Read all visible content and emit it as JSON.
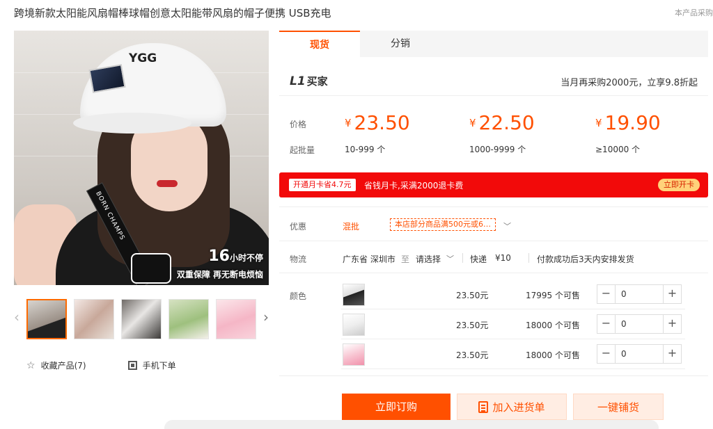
{
  "product_title": "跨境新款太阳能风扇帽棒球帽创意太阳能带风扇的帽子便携 USB充电",
  "top_right_note": "本产品采购",
  "image_overlay": {
    "line1_num": "16",
    "line1_text": "小时不停",
    "line2": "双重保障 再无断电烦恼"
  },
  "cap_text": "YGG",
  "strap_text": "BORN CHAMPS",
  "left_actions": {
    "favorite": "收藏产品(7)",
    "mobile": "手机下单"
  },
  "tabs": [
    "现货",
    "分销"
  ],
  "buyer": {
    "level": "L1",
    "label": "买家",
    "note": "当月再采购2000元，立享9.8折起"
  },
  "pricing": {
    "price_label": "价格",
    "moq_label": "起批量",
    "currency": "¥",
    "tiers": [
      {
        "price": "23.50",
        "range": "10-999 个"
      },
      {
        "price": "22.50",
        "range": "1000-9999 个"
      },
      {
        "price": "19.90",
        "range": "≥10000 个"
      }
    ]
  },
  "promo": {
    "tag": "开通月卡省4.7元",
    "text": "省钱月卡,采满2000退卡费",
    "button": "立即开卡"
  },
  "discount": {
    "label": "优惠",
    "type": "混批",
    "coupon": "本店部分商品满500元或6…"
  },
  "logistics": {
    "label": "物流",
    "origin": "广东省 深圳市",
    "to": "至",
    "select": "请选择",
    "method": "快递",
    "fee": "¥10",
    "note": "付款成功后3天内安排发货"
  },
  "color": {
    "label": "颜色",
    "rows": [
      {
        "swatch": "black",
        "price": "23.50元",
        "stock": "17995 个可售",
        "qty": "0"
      },
      {
        "swatch": "white",
        "price": "23.50元",
        "stock": "18000 个可售",
        "qty": "0"
      },
      {
        "swatch": "pink",
        "price": "23.50元",
        "stock": "18000 个可售",
        "qty": "0"
      }
    ]
  },
  "cta": {
    "buy": "立即订购",
    "cart": "加入进货单",
    "dist": "一键铺货"
  },
  "colors": {
    "accent": "#ff5000",
    "promo_red": "#f20a0a"
  }
}
